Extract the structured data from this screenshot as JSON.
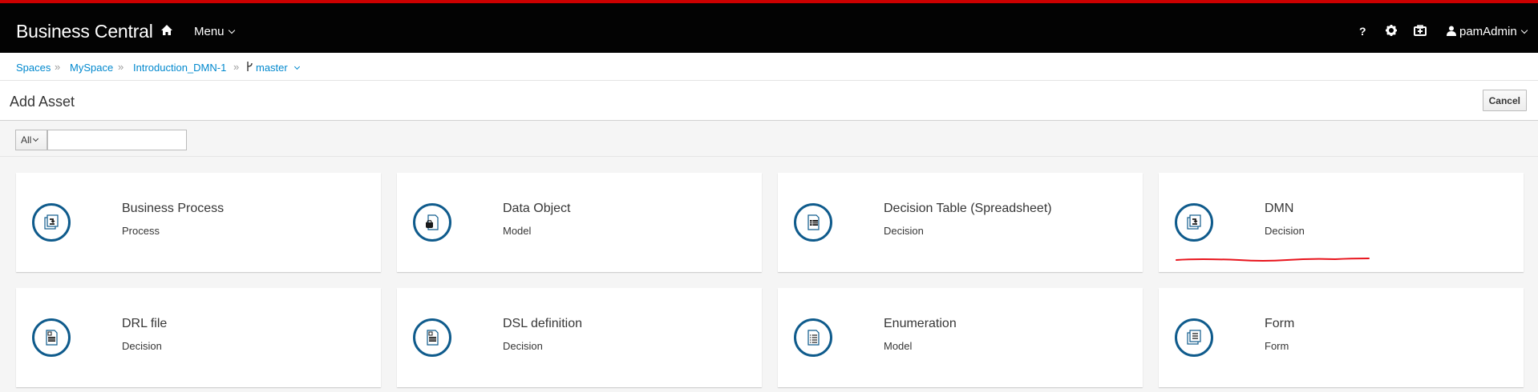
{
  "app": {
    "brand": "Business Central"
  },
  "nav": {
    "menu_label": "Menu",
    "user_label": "pamAdmin",
    "help_label": "?"
  },
  "breadcrumb": {
    "items": [
      "Spaces",
      "MySpace",
      "Introduction_DMN-1",
      "master"
    ],
    "separator": "»"
  },
  "page": {
    "title": "Add Asset",
    "cancel_label": "Cancel"
  },
  "filter": {
    "selected": "All",
    "search_value": ""
  },
  "cards": [
    {
      "title": "Business Process",
      "subtitle": "Process",
      "icon": "business-process-icon"
    },
    {
      "title": "Data Object",
      "subtitle": "Model",
      "icon": "data-object-icon"
    },
    {
      "title": "Decision Table (Spreadsheet)",
      "subtitle": "Decision",
      "icon": "decision-table-icon"
    },
    {
      "title": "DMN",
      "subtitle": "Decision",
      "icon": "dmn-icon"
    },
    {
      "title": "DRL file",
      "subtitle": "Decision",
      "icon": "drl-file-icon"
    },
    {
      "title": "DSL definition",
      "subtitle": "Decision",
      "icon": "dsl-definition-icon"
    },
    {
      "title": "Enumeration",
      "subtitle": "Model",
      "icon": "enumeration-icon"
    },
    {
      "title": "Form",
      "subtitle": "Form",
      "icon": "form-icon"
    }
  ],
  "colors": {
    "navbar_bg": "#030303",
    "accent_top": "#cc0000",
    "link": "#0088ce",
    "icon_ring": "#0f5b8c",
    "annotation": "#e8141c"
  }
}
